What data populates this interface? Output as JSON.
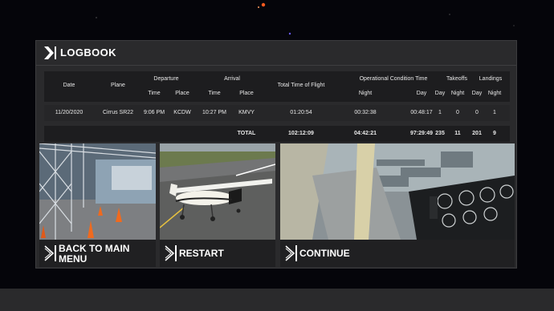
{
  "logbook": {
    "title": "LOGBOOK",
    "headers": {
      "date": "Date",
      "plane": "Plane",
      "departure": "Departure",
      "arrival": "Arrival",
      "total_time": "Total Time of Flight",
      "operational": "Operational Condition Time",
      "takeoffs": "Takeoffs",
      "landings": "Landings",
      "time": "Time",
      "place": "Place",
      "night": "Night",
      "day": "Day"
    },
    "row": {
      "date": "11/20/2020",
      "plane": "Cirrus SR22",
      "dep_time": "9:06 PM",
      "dep_place": "KCDW",
      "arr_time": "10:27 PM",
      "arr_place": "KMVY",
      "total_time": "01:20:54",
      "op_night": "00:32:38",
      "op_day": "00:48:17",
      "takeoffs_day": "1",
      "takeoffs_night": "0",
      "landings_day": "0",
      "landings_night": "1"
    },
    "total": {
      "label": "TOTAL",
      "total_time": "102:12:09",
      "op_night": "04:42:21",
      "op_day": "97:29:49",
      "takeoffs_day": "235",
      "takeoffs_night": "11",
      "landings_day": "201",
      "landings_night": "9"
    }
  },
  "actions": {
    "back_line1": "BACK TO MAIN",
    "back_line2": "MENU",
    "restart": "RESTART",
    "continue": "CONTINUE"
  },
  "colors": {
    "panel": "#2a2a2c",
    "header_row": "#1d1d1f",
    "text": "#ffffff"
  }
}
